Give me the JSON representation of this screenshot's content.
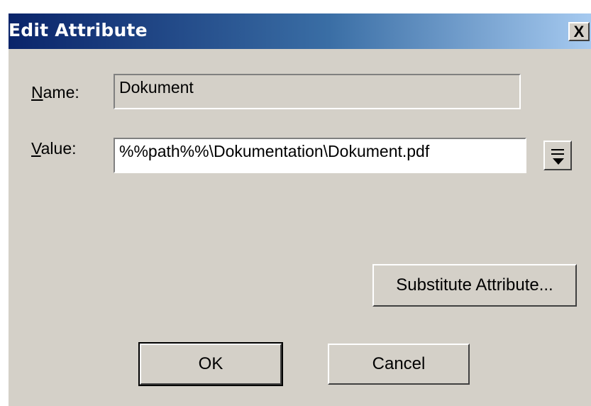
{
  "dialog": {
    "title": "Edit Attribute",
    "close_symbol": "X"
  },
  "name_field": {
    "label_mnemonic": "N",
    "label_rest": "ame:",
    "value": "Dokument"
  },
  "value_field": {
    "label_mnemonic": "V",
    "label_rest": "alue:",
    "value": "%%path%%\\Dokumentation\\Dokument.pdf",
    "menu_icon": "dropdown-menu-icon"
  },
  "buttons": {
    "substitute_label": "Substitute Attribute...",
    "ok_label": "OK",
    "cancel_label": "Cancel"
  }
}
